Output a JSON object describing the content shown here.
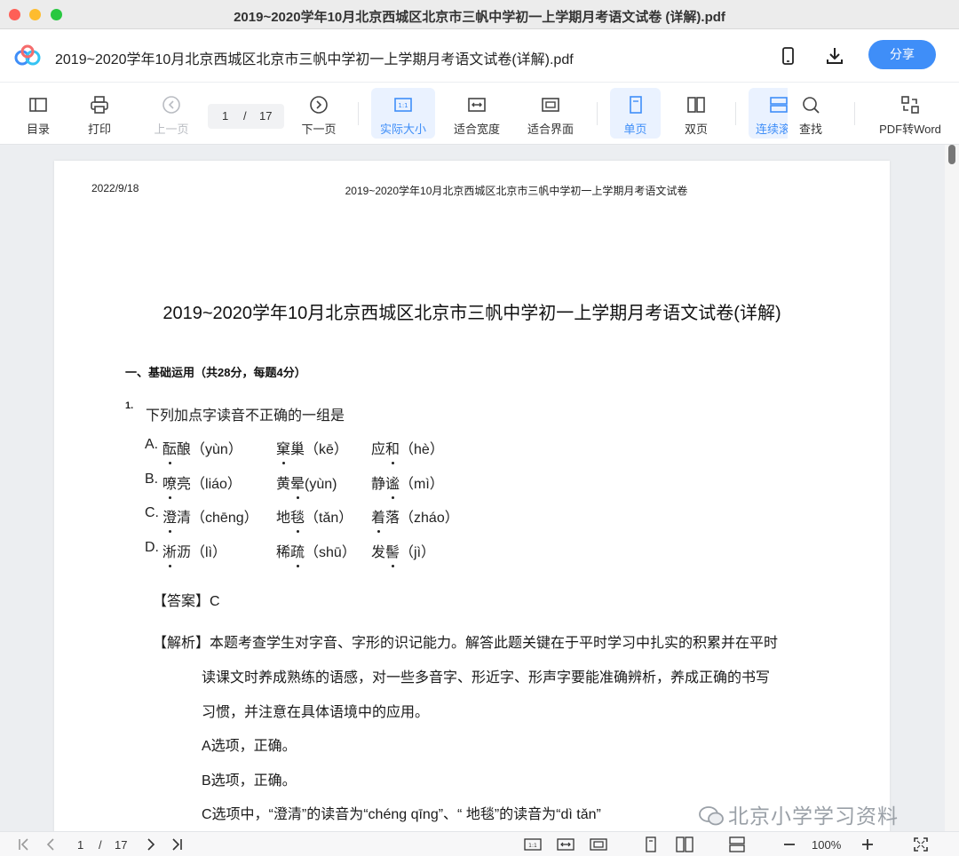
{
  "window": {
    "title": "2019~2020学年10月北京西城区北京市三帆中学初一上学期月考语文试卷 (详解).pdf"
  },
  "header": {
    "doc_name": "2019~2020学年10月北京西城区北京市三帆中学初一上学期月考语文试卷(详解).pdf",
    "share_label": "分享"
  },
  "toolbar": {
    "toc": "目录",
    "print": "打印",
    "prev": "上一页",
    "next": "下一页",
    "current_page": "1",
    "slash": "/",
    "total_pages": "17",
    "actual_size": "实际大小",
    "fit_width": "适合宽度",
    "fit_page": "适合界面",
    "single": "单页",
    "double": "双页",
    "continuous": "连续滚",
    "find": "查找",
    "pdf_to_word": "PDF转Word"
  },
  "page": {
    "date": "2022/9/18",
    "running_header": "2019~2020学年10月北京西城区北京市三帆中学初一上学期月考语文试卷",
    "title": "2019~2020学年10月北京西城区北京市三帆中学初一上学期月考语文试卷(详解)",
    "section": "一、基础运用（共28分，每题4分）",
    "question_number": "1.",
    "question_text": "下列加点字读音不正确的一组是",
    "options": [
      {
        "label": "A.",
        "items": [
          {
            "pre": "",
            "dotted": "酝",
            "post": "酿（yùn）"
          },
          {
            "pre": "",
            "dotted": "窠",
            "post": "巢（kē）"
          },
          {
            "pre": "应",
            "dotted": "和",
            "post": "（hè）"
          }
        ]
      },
      {
        "label": "B.",
        "items": [
          {
            "pre": "",
            "dotted": "嘹",
            "post": "亮（liáo）"
          },
          {
            "pre": "黄",
            "dotted": "晕",
            "post": "(yùn)"
          },
          {
            "pre": "静",
            "dotted": "谧",
            "post": "（mì）"
          }
        ]
      },
      {
        "label": "C.",
        "items": [
          {
            "pre": "",
            "dotted": "澄",
            "post": "清（chēng）"
          },
          {
            "pre": "地",
            "dotted": "毯",
            "post": "（tǎn）"
          },
          {
            "pre": "",
            "dotted": "着",
            "post": "落（zháo）"
          }
        ]
      },
      {
        "label": "D.",
        "items": [
          {
            "pre": "",
            "dotted": "淅",
            "post": "沥（lì）"
          },
          {
            "pre": "稀",
            "dotted": "疏",
            "post": "（shū）"
          },
          {
            "pre": "发",
            "dotted": "髻",
            "post": "（jì）"
          }
        ]
      }
    ],
    "answer": "【答案】C",
    "analysis": [
      "【解析】本题考查学生对字音、字形的识记能力。解答此题关键在于平时学习中扎实的积累并在平时",
      "读课文时养成熟练的语感，对一些多音字、形近字、形声字要能准确辨析，养成正确的书写",
      "习惯，并注意在具体语境中的应用。",
      "A选项，正确。",
      "B选项，正确。",
      "C选项中，“澄清”的读音为“chéng qīng”、“ 地毯”的读音为“dì tǎn”"
    ]
  },
  "watermark": "北京小学学习资料",
  "bottombar": {
    "current_page": "1",
    "slash": "/",
    "total_pages": "17",
    "zoom": "100%"
  },
  "colors": {
    "accent": "#3f8ef8",
    "active_bg": "#eaf2ff"
  }
}
